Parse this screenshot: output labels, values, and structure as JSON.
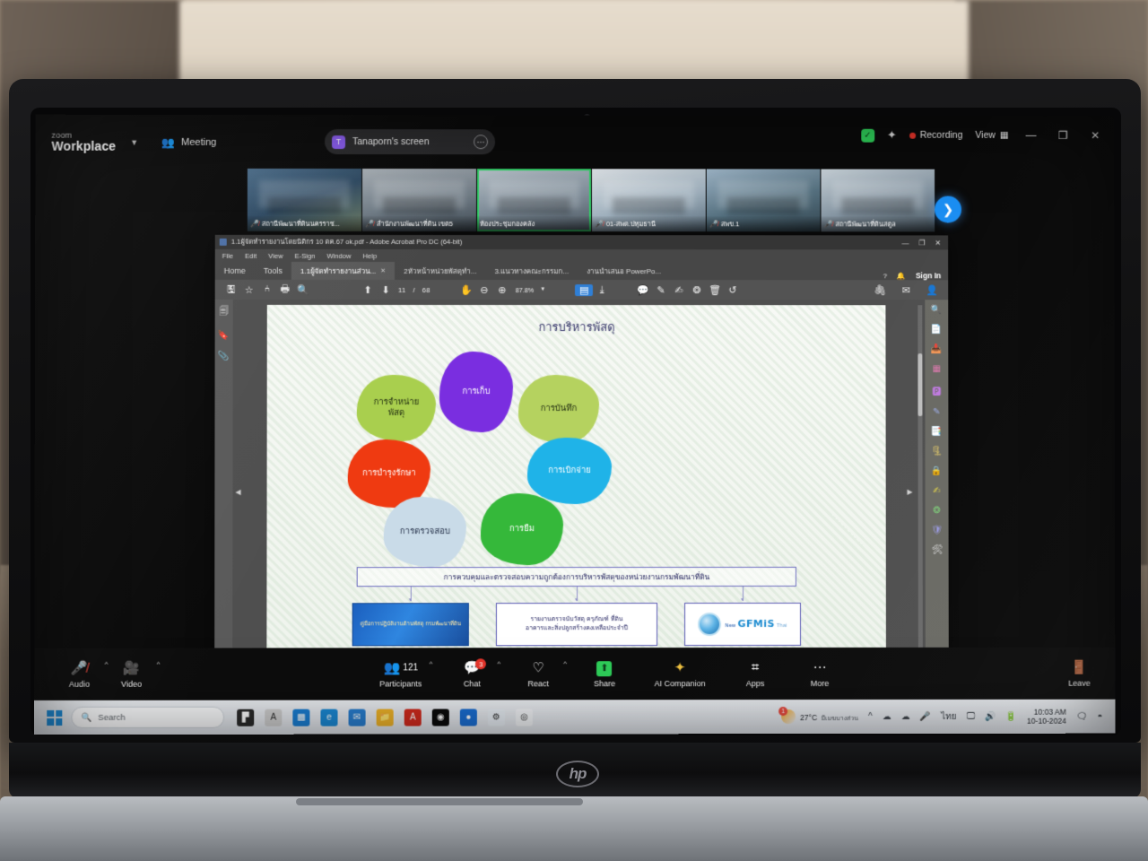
{
  "zoom_app": {
    "logo_line1": "zoom",
    "logo_line2": "Workplace",
    "meeting_label": "Meeting",
    "meeting_icon": "people-icon",
    "chevron_icon": "chevron-down-icon",
    "shared_screen_pill": {
      "avatar_initial": "T",
      "label": "Tanaporn's screen",
      "more_icon": "more-horizontal-icon"
    },
    "top_right": {
      "shield_icon": "shield-check-icon",
      "sparkle_icon": "ai-sparkle-icon",
      "recording_label": "Recording",
      "view_label": "View",
      "view_icon": "grid-layout-icon",
      "minimize_icon": "minimize-icon",
      "maximize_icon": "restore-icon",
      "close_icon": "close-icon"
    },
    "next_page_icon": "chevron-right-icon",
    "thumbnails": [
      {
        "label": "สถานีพัฒนาที่ดินนครราช...",
        "muted": true,
        "active": false,
        "tint": "t1"
      },
      {
        "label": "สำนักงานพัฒนาที่ดิน เขต5",
        "muted": true,
        "active": false,
        "tint": "t2"
      },
      {
        "label": "ห้องประชุมกองคลัง",
        "muted": false,
        "active": true,
        "tint": "t3"
      },
      {
        "label": "01-สพด.ปทุมธานี",
        "muted": true,
        "active": false,
        "tint": "t4"
      },
      {
        "label": "สพข.1",
        "muted": true,
        "active": false,
        "tint": "t5"
      },
      {
        "label": "สถานีพัฒนาที่ดินสตูล",
        "muted": true,
        "active": false,
        "tint": "t6"
      }
    ],
    "bottom_bar": {
      "audio": {
        "label": "Audio",
        "icon": "microphone-muted-icon",
        "muted": true
      },
      "video": {
        "label": "Video",
        "icon": "camera-icon"
      },
      "participants": {
        "label": "Participants",
        "icon": "participants-icon",
        "count": "121"
      },
      "chat": {
        "label": "Chat",
        "icon": "chat-icon",
        "badge": "3"
      },
      "react": {
        "label": "React",
        "icon": "heart-icon"
      },
      "share": {
        "label": "Share",
        "icon": "share-screen-icon"
      },
      "ai_companion": {
        "label": "AI Companion",
        "icon": "ai-sparkle-icon"
      },
      "apps": {
        "label": "Apps",
        "icon": "apps-icon"
      },
      "more": {
        "label": "More",
        "icon": "more-horizontal-icon"
      },
      "leave": {
        "label": "Leave",
        "icon": "leave-meeting-icon"
      }
    }
  },
  "acrobat": {
    "window_title": "1.1ผู้จัดทำรายงานโดยนิติกร 10 ตค.67 ok.pdf - Adobe Acrobat Pro DC (64-bit)",
    "window_controls": {
      "minimize": "—",
      "restore": "❐",
      "close": "✕"
    },
    "menus": [
      "File",
      "Edit",
      "View",
      "E-Sign",
      "Window",
      "Help"
    ],
    "tabs": [
      {
        "label": "Home",
        "selected": false,
        "closable": false
      },
      {
        "label": "Tools",
        "selected": false,
        "closable": false
      },
      {
        "label": "1.1ผู้จัดทำรายงานส่วน...",
        "selected": true,
        "closable": true
      },
      {
        "label": "2หัวหน้าหน่วยพัสดุทำ...",
        "selected": false,
        "closable": false
      },
      {
        "label": "3.แนวทางคณะกรรมก...",
        "selected": false,
        "closable": false
      },
      {
        "label": "งานนำเสนอ PowerPo...",
        "selected": false,
        "closable": false
      }
    ],
    "tab_right": {
      "help_icon": "help-circle-icon",
      "bell_icon": "notification-bell-icon",
      "sign_in_label": "Sign In"
    },
    "toolbar": {
      "save_icon": "save-icon",
      "star_icon": "star-icon",
      "share_icon": "share-node-icon",
      "print_icon": "print-icon",
      "search_icon": "search-icon",
      "prev_page_icon": "arrow-up-circle-icon",
      "next_page_icon": "arrow-down-circle-icon",
      "current_page": "11",
      "page_separator": "/",
      "total_pages": "68",
      "hand_tool_icon": "hand-tool-icon",
      "zoom_out_icon": "zoom-out-icon",
      "zoom_in_icon": "zoom-in-icon",
      "zoom_level": "87.8%",
      "zoom_caret_icon": "chevron-down-icon",
      "select_tool_icon": "page-select-icon",
      "download_icon": "download-icon",
      "comment_icon": "comment-icon",
      "highlight_icon": "highlight-pen-icon",
      "signature_icon": "signature-icon",
      "stamp_icon": "stamp-icon",
      "delete_icon": "trash-icon",
      "undo_icon": "undo-icon",
      "attach_icon": "attach-cloud-icon",
      "mail_icon": "mail-icon",
      "account_icon": "account-add-icon"
    },
    "left_rail": [
      "page-thumbnails-icon",
      "bookmark-icon",
      "attachment-icon"
    ],
    "right_rail": [
      "search-tool-icon",
      "export-pdf-icon",
      "create-pdf-icon",
      "organize-pages-icon",
      "edit-pdf-icon",
      "comment-tool-icon",
      "combine-files-icon",
      "compress-pdf-icon",
      "protect-pdf-icon",
      "fill-sign-icon",
      "stamp-tool-icon",
      "certificate-icon",
      "more-tools-icon"
    ]
  },
  "pdf_slide": {
    "title": "การบริหารพัสดุ",
    "petals": [
      {
        "label": "การจำหน่าย\nพัสดุ",
        "color": "#a9cf4e",
        "text_color": "#1e2a10"
      },
      {
        "label": "การเก็บ",
        "color": "#7a2ee0",
        "text_color": "#ffffff"
      },
      {
        "label": "การบันทึก",
        "color": "#b5d25f",
        "text_color": "#1e2a10"
      },
      {
        "label": "การบำรุงรักษา",
        "color": "#ef3a11",
        "text_color": "#ffffff"
      },
      {
        "label": "การเบิกจ่าย",
        "color": "#1fb3e8",
        "text_color": "#ffffff"
      },
      {
        "label": "การตรวจสอบ",
        "color": "#c9dbe8",
        "text_color": "#26324a"
      },
      {
        "label": "การยืม",
        "color": "#35b83a",
        "text_color": "#ffffff"
      }
    ],
    "banner": "การควบคุมและตรวจสอบความถูกต้องการบริหารพัสดุของหน่วยงานกรมพัฒนาที่ดิน",
    "boxes": [
      {
        "type": "image",
        "label": "คู่มือการปฏิบัติงานด้านพัสดุ กรมพัฒนาที่ดิน"
      },
      {
        "type": "text",
        "label": "รายงานตรวจนับวัสดุ ครุภัณฑ์ ที่ดิน\nอาคารและสิ่งปลูกสร้างคงเหลือประจำปี"
      },
      {
        "type": "logo",
        "line1": "New",
        "line2": "GFMiS",
        "line3": "Thai"
      }
    ]
  },
  "taskbar": {
    "start_icon": "windows-start-icon",
    "search_placeholder": "Search",
    "search_icon": "search-icon",
    "widget_icon": "weather-widget-icon",
    "apps": [
      {
        "name": "task-view-icon",
        "color": "#2b2b2b",
        "glyph": "▛"
      },
      {
        "name": "acrobat-reader-icon",
        "color": "#cfcfcf",
        "glyph": "A"
      },
      {
        "name": "store-icon",
        "color": "#1b7fd4",
        "glyph": "▩"
      },
      {
        "name": "edge-icon",
        "color": "#1b8ad6",
        "glyph": "e"
      },
      {
        "name": "mail-icon",
        "color": "#2a7fd0",
        "glyph": "✉"
      },
      {
        "name": "file-explorer-icon",
        "color": "#f0b429",
        "glyph": "📁"
      },
      {
        "name": "adobe-acrobat-icon",
        "color": "#d32b1e",
        "glyph": "A"
      },
      {
        "name": "zoom-app-icon",
        "color": "#0b0b0b",
        "glyph": "◉"
      },
      {
        "name": "line-app-icon",
        "color": "#1b6fd4",
        "glyph": "●"
      },
      {
        "name": "settings-icon",
        "color": "#e8eef4",
        "glyph": "⚙"
      },
      {
        "name": "chrome-icon",
        "color": "#f2f4f7",
        "glyph": "◎"
      }
    ],
    "tray": {
      "overflow_icon": "chevron-up-icon",
      "cloud_icons": [
        "onedrive-icon",
        "onedrive-personal-icon"
      ],
      "mic_icon": "microphone-icon",
      "language": "ไทย",
      "monitor_icon": "display-icon",
      "volume_icon": "speaker-icon",
      "battery_icon": "battery-icon",
      "time": "10:03 AM",
      "date": "10-10-2024",
      "notification_icon": "notification-icon",
      "copilot_icon": "copilot-icon"
    },
    "weather": {
      "temp": "27°C",
      "desc": "มีเมฆบางส่วน",
      "badge": "1"
    }
  }
}
